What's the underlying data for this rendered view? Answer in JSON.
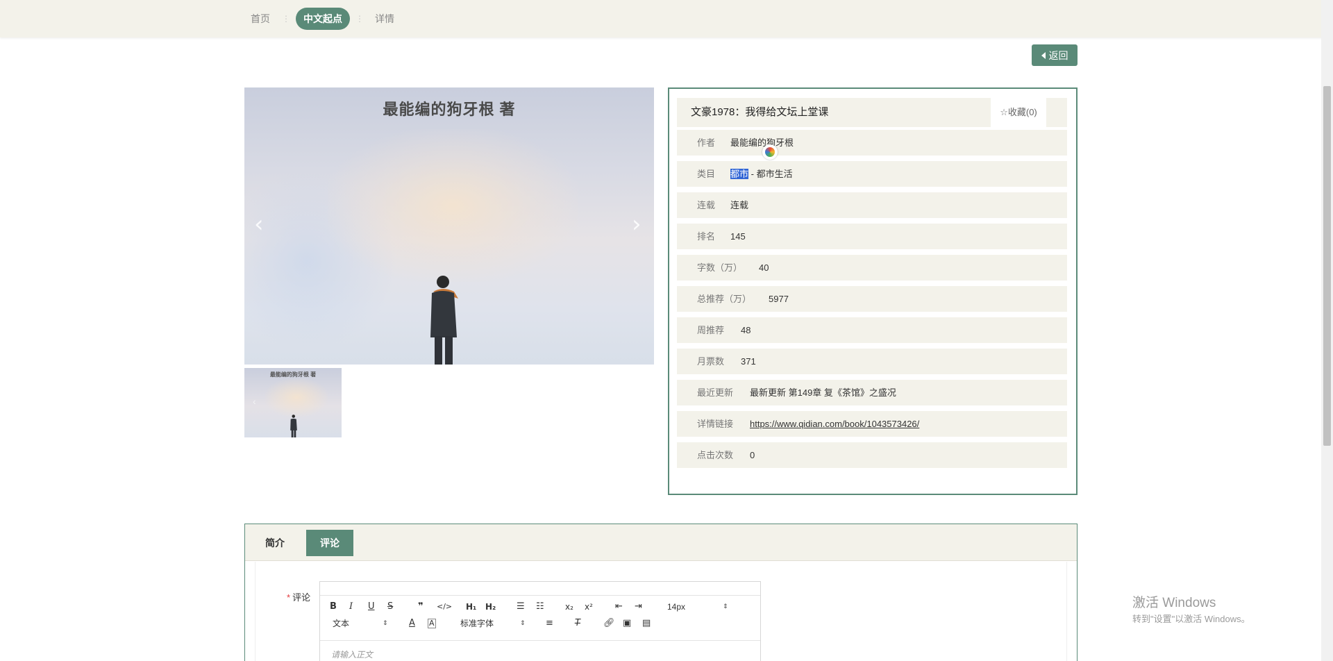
{
  "breadcrumb": {
    "home": "首页",
    "sep": "⋮",
    "current": "中文起点",
    "detail": "详情"
  },
  "back_button": {
    "label": "返回"
  },
  "cover": {
    "author_line": "最能编的狗牙根 著"
  },
  "book": {
    "title": "文豪1978：我得给文坛上堂课",
    "favorite_label": "收藏(0)",
    "rows": {
      "author": {
        "label": "作者",
        "value": "最能编的狗牙根"
      },
      "category": {
        "label": "类目",
        "value_selected": "都市",
        "value_rest": "- 都市生活"
      },
      "serial": {
        "label": "连载",
        "value": "连载"
      },
      "rank": {
        "label": "排名",
        "value": "145"
      },
      "words": {
        "label": "字数（万）",
        "value": "40"
      },
      "total_rec": {
        "label": "总推荐（万）",
        "value": "5977"
      },
      "weekly_rec": {
        "label": "周推荐",
        "value": "48"
      },
      "monthly_votes": {
        "label": "月票数",
        "value": "371"
      },
      "latest": {
        "label": "最近更新",
        "value": "最新更新 第149章 复《茶馆》之盛况"
      },
      "link": {
        "label": "详情链接",
        "value": "https://www.qidian.com/book/1043573426/"
      },
      "clicks": {
        "label": "点击次数",
        "value": "0"
      }
    }
  },
  "tabs": {
    "intro": "简介",
    "comment": "评论"
  },
  "comment_form": {
    "label": "评论",
    "toolbar": {
      "h1": "H₁",
      "h2": "H₂",
      "sub": "x₂",
      "sup": "x²",
      "font_size": "14px",
      "text_type": "文本",
      "font_family": "标准字体"
    },
    "placeholder": "请输入正文"
  },
  "watermark": {
    "line1": "激活 Windows",
    "line2": "转到\"设置\"以激活 Windows。"
  },
  "colors": {
    "accent": "#5a8a78",
    "row_bg": "#f3f2ea",
    "selection": "#3367d6"
  },
  "icons": [
    "caret-left-icon",
    "chevron-left-icon",
    "chevron-right-icon",
    "star-outline-icon",
    "bold-icon",
    "italic-icon",
    "underline-icon",
    "strike-icon",
    "quote-icon",
    "code-icon",
    "ordered-list-icon",
    "bullet-list-icon",
    "indent-icon",
    "outdent-icon",
    "font-color-icon",
    "background-color-icon",
    "align-icon",
    "clear-format-icon",
    "link-icon",
    "image-icon",
    "video-icon"
  ]
}
